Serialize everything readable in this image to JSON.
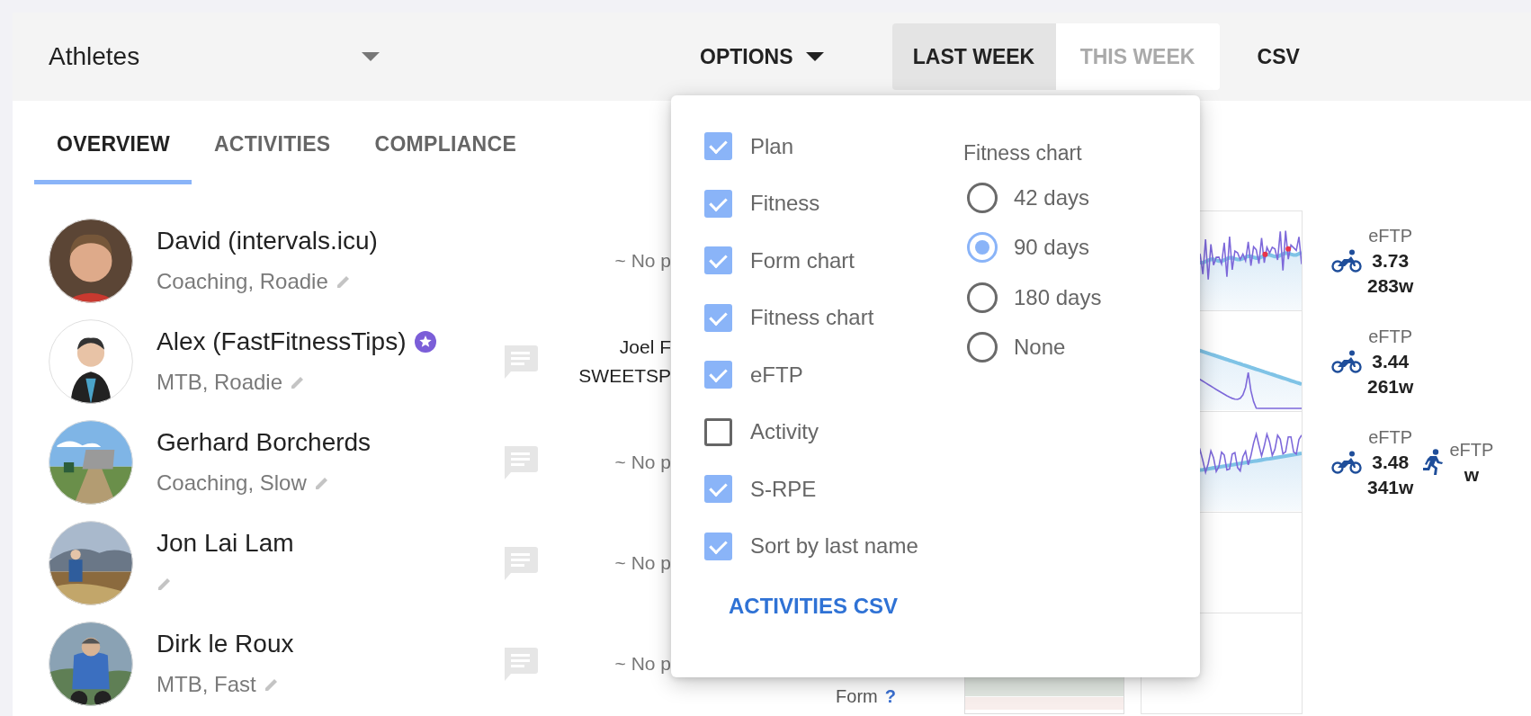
{
  "top_bar": {
    "athlete_select": {
      "value": "Athletes"
    },
    "options_button": {
      "label": "OPTIONS"
    },
    "week_toggle": [
      {
        "label": "LAST WEEK",
        "selected": true
      },
      {
        "label": "THIS WEEK",
        "selected": false
      }
    ],
    "csv_button": {
      "label": "CSV"
    }
  },
  "tabs": [
    {
      "label": "OVERVIEW",
      "selected": true
    },
    {
      "label": "ACTIVITIES",
      "selected": false
    },
    {
      "label": "COMPLIANCE",
      "selected": false
    }
  ],
  "athletes": [
    {
      "name": "David (intervals.icu)",
      "tags": "Coaching, Roadie",
      "starred": false,
      "comment": false,
      "plan": {
        "kind": "none",
        "lines": [
          "~ No p"
        ]
      },
      "fitness_chart": true,
      "eftp": [
        {
          "kind": "ride",
          "label": "eFTP",
          "value": "3.73",
          "watts": "283w"
        }
      ]
    },
    {
      "name": "Alex (FastFitnessTips)",
      "tags": "MTB, Roadie",
      "starred": true,
      "comment": true,
      "plan": {
        "kind": "workout",
        "lines": [
          "Joel F",
          "SWEETSP"
        ]
      },
      "fitness_chart": true,
      "eftp": [
        {
          "kind": "ride",
          "label": "eFTP",
          "value": "3.44",
          "watts": "261w"
        }
      ]
    },
    {
      "name": "Gerhard Borcherds",
      "tags": "Coaching, Slow",
      "starred": false,
      "comment": true,
      "plan": {
        "kind": "none",
        "lines": [
          "~ No p"
        ]
      },
      "fitness_chart": true,
      "eftp": [
        {
          "kind": "ride",
          "label": "eFTP",
          "value": "3.48",
          "watts": "341w"
        },
        {
          "kind": "run",
          "label": "eFTP",
          "watts": "w"
        }
      ]
    },
    {
      "name": "Jon Lai Lam",
      "starred": false,
      "comment": true,
      "plan": {
        "kind": "none",
        "lines": [
          "~ No p"
        ]
      },
      "fitness_chart": false
    },
    {
      "name": "Dirk le Roux",
      "tags": "MTB, Fast",
      "starred": false,
      "comment": true,
      "plan": {
        "kind": "none",
        "lines": [
          "~ No p"
        ]
      },
      "form": {
        "label": "Form",
        "help": "?"
      },
      "fitness_chart": false
    }
  ],
  "options_menu": {
    "checks": [
      {
        "label": "Plan",
        "checked": true
      },
      {
        "label": "Fitness",
        "checked": true
      },
      {
        "label": "Form chart",
        "checked": true
      },
      {
        "label": "Fitness chart",
        "checked": true
      },
      {
        "label": "eFTP",
        "checked": true
      },
      {
        "label": "Activity",
        "checked": false
      },
      {
        "label": "S-RPE",
        "checked": true
      },
      {
        "label": "Sort by last name",
        "checked": true
      }
    ],
    "fitness_chart": {
      "title": "Fitness chart",
      "choices": [
        {
          "label": "42 days",
          "selected": false
        },
        {
          "label": "90 days",
          "selected": true
        },
        {
          "label": "180 days",
          "selected": false
        },
        {
          "label": "None",
          "selected": false
        }
      ]
    },
    "csv_link": "ACTIVITIES CSV"
  }
}
